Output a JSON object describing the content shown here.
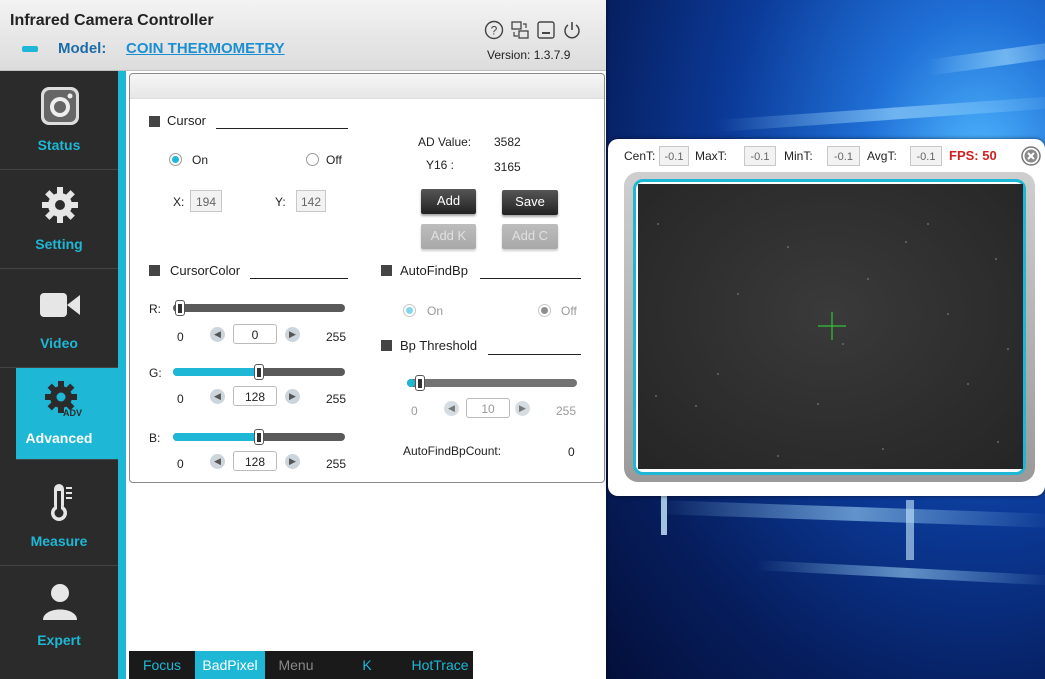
{
  "app": {
    "title": "Infrared Camera Controller",
    "model_label": "Model:",
    "model_value": "COIN THERMOMETRY",
    "version": "Version:  1.3.7.9"
  },
  "titlebar_icons": [
    "help-icon",
    "switch-display-icon",
    "minimize-icon",
    "power-icon"
  ],
  "sidebar": {
    "items": [
      {
        "label": "Status",
        "icon": "camera-icon",
        "active": false
      },
      {
        "label": "Setting",
        "icon": "gear-icon",
        "active": false
      },
      {
        "label": "Video",
        "icon": "video-camera-icon",
        "active": false
      },
      {
        "label": "Advanced",
        "icon": "advanced-gear-icon",
        "active": true
      },
      {
        "label": "Measure",
        "icon": "thermometer-icon",
        "active": false
      },
      {
        "label": "Expert",
        "icon": "user-icon",
        "active": false
      }
    ],
    "adv_badge": "ADV"
  },
  "cursor": {
    "title": "Cursor",
    "on_label": "On",
    "off_label": "Off",
    "selected": "On",
    "x_label": "X:",
    "x_value": "194",
    "y_label": "Y:",
    "y_value": "142"
  },
  "readout": {
    "ad_label": "AD Value:",
    "ad_value": "3582",
    "y16_label": "Y16 :",
    "y16_value": "3165"
  },
  "buttons": {
    "add": "Add",
    "save": "Save",
    "add_k": "Add K",
    "add_c": "Add C"
  },
  "cursor_color": {
    "title": "CursorColor",
    "min": "0",
    "max": "255",
    "r": {
      "label": "R:",
      "value": "0",
      "fraction": 0.0
    },
    "g": {
      "label": "G:",
      "value": "128",
      "fraction": 0.5
    },
    "b": {
      "label": "B:",
      "value": "128",
      "fraction": 0.5
    }
  },
  "auto_find_bp": {
    "title": "AutoFindBp",
    "on_label": "On",
    "off_label": "Off",
    "selected": "Off"
  },
  "bp_threshold": {
    "title": "Bp Threshold",
    "min": "0",
    "max": "255",
    "value": "10",
    "fraction": 0.04,
    "count_label": "AutoFindBpCount:",
    "count_value": "0"
  },
  "tabs": [
    {
      "label": "Focus",
      "state": "normal"
    },
    {
      "label": "BadPixel",
      "state": "active"
    },
    {
      "label": "Menu",
      "state": "gray"
    },
    {
      "label": "K",
      "state": "normal"
    },
    {
      "label": "HotTrace",
      "state": "normal"
    }
  ],
  "viewer": {
    "cen_label": "CenT:",
    "cen_value": "-0.1",
    "max_label": "MaxT:",
    "max_value": "-0.1",
    "min_label": "MinT:",
    "min_value": "-0.1",
    "avg_label": "AvgT:",
    "avg_value": "-0.1",
    "fps_label": "FPS: 50"
  },
  "colors": {
    "accent": "#1eb7d6",
    "sidebar_bg": "#2b2b2b",
    "fps_red": "#d22020",
    "crosshair": "#35c235"
  }
}
